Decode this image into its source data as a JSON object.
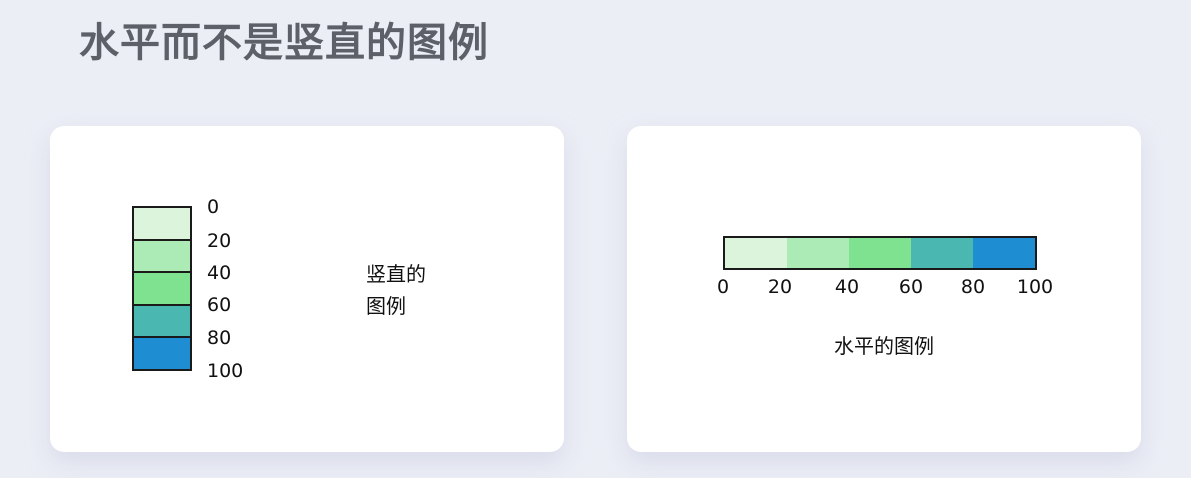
{
  "page_title": "水平而不是竖直的图例",
  "vertical_legend": {
    "caption_line1": "竖直的",
    "caption_line2": "图例",
    "colors": [
      "#ddf4dc",
      "#acebb6",
      "#7fe291",
      "#4ab8b1",
      "#1f8dd1"
    ],
    "ticks": [
      "0",
      "20",
      "40",
      "60",
      "80",
      "100"
    ]
  },
  "horizontal_legend": {
    "caption": "水平的图例",
    "colors": [
      "#ddf4dc",
      "#acebb6",
      "#7fe291",
      "#4ab8b1",
      "#1f8dd1"
    ],
    "ticks": [
      "0",
      "20",
      "40",
      "60",
      "80",
      "100"
    ]
  }
}
